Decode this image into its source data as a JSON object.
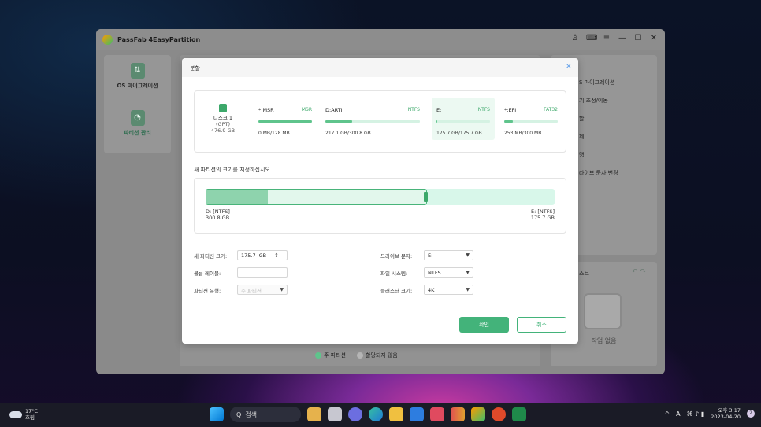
{
  "app": {
    "title": "PassFab 4EasyPartition"
  },
  "window_controls": {
    "user": "♙",
    "feedback": "⌨",
    "menu": "≡",
    "minimize": "—",
    "maximize": "☐",
    "close": "✕"
  },
  "sidebar": {
    "items": [
      {
        "label": "OS 마이그레이션",
        "icon": "migrate-icon"
      },
      {
        "label": "파티션 관리",
        "icon": "partition-manage-icon"
      }
    ]
  },
  "right_panel": {
    "items": [
      "S 마이그레이션",
      "기 조정/이동",
      "할",
      "제",
      "맷",
      "라이브 문자 변경"
    ]
  },
  "ops_panel": {
    "title": "스트",
    "empty": "작업 없음"
  },
  "legend": {
    "primary": "주 파티션",
    "unallocated": "할당되지 않음"
  },
  "dialog": {
    "title": "분할",
    "close": "×",
    "disk": {
      "name": "디스크 1",
      "scheme": "(GPT)",
      "size": "476.9 GB"
    },
    "partitions": [
      {
        "name": "*:MSR",
        "fs": "MSR",
        "size": "0 MB/128 MB",
        "used": 1.0
      },
      {
        "name": "D:ARTI",
        "fs": "NTFS",
        "size": "217.1 GB/300.8 GB",
        "used": 0.28
      },
      {
        "name": "E:",
        "fs": "NTFS",
        "size": "175.7 GB/175.7 GB",
        "used": 0.02
      },
      {
        "name": "*:EFI",
        "fs": "FAT32",
        "size": "253 MB/300 MB",
        "used": 0.16
      }
    ],
    "instruction": "새 파티션의 크기를 지정하십시오.",
    "resize": {
      "left_label": "D: [NTFS]",
      "left_size": "300.8 GB",
      "right_label": "E: [NTFS]",
      "right_size": "175.7 GB",
      "used_fraction": 0.28,
      "split_fraction": 0.634
    },
    "form": {
      "new_size_label": "새 파티션 크기:",
      "new_size_value": "175.7",
      "new_size_unit": "GB",
      "stepper": "⇕",
      "volume_label": "볼륨 레이블:",
      "volume_value": "",
      "type_label": "파티션 유형:",
      "type_value": "주 파티션",
      "drive_letter_label": "드라이브 문자:",
      "drive_letter_value": "E:",
      "fs_label": "파일 시스템:",
      "fs_value": "NTFS",
      "cluster_label": "클러스터 크기:",
      "cluster_value": "4K"
    },
    "ok": "확인",
    "cancel": "취소"
  },
  "taskbar": {
    "weather_temp": "17°C",
    "weather_desc": "흐림",
    "search": "검색",
    "search_icon": "Q",
    "caret": "^",
    "ime": "A",
    "icons": "⌘ ♪ ▮",
    "clock_time": "오후 3:17",
    "clock_date": "2023-04-20",
    "notif_count": "2"
  }
}
